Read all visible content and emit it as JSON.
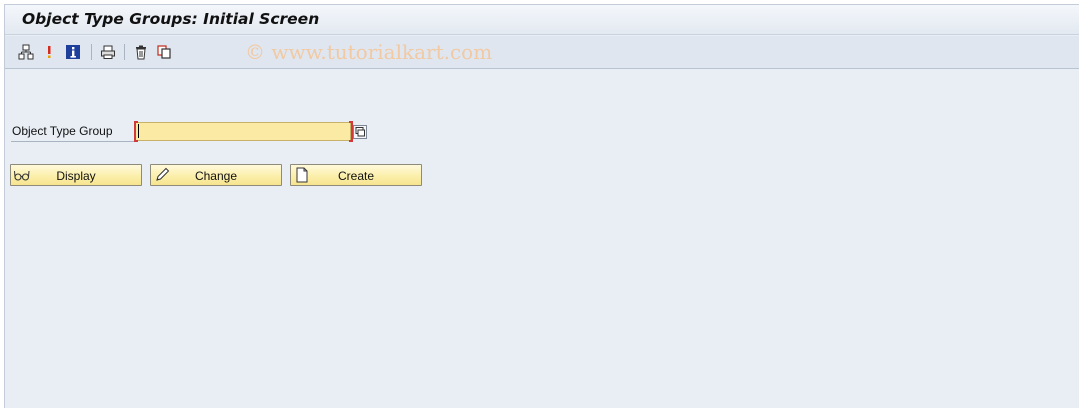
{
  "header": {
    "title": "Object Type Groups: Initial Screen"
  },
  "toolbar": {
    "icons": [
      "hierarchy-icon",
      "exclamation-icon",
      "info-icon",
      "print-icon",
      "delete-icon",
      "copy-icon"
    ],
    "watermark": "© www.tutorialkart.com"
  },
  "form": {
    "object_type_group": {
      "label": "Object Type Group",
      "value": ""
    }
  },
  "buttons": {
    "display": "Display",
    "change": "Change",
    "create": "Create"
  },
  "colors": {
    "input_bg": "#fbeaa4",
    "button_bg": "#fbefab",
    "required_marker": "#d13a3a"
  }
}
